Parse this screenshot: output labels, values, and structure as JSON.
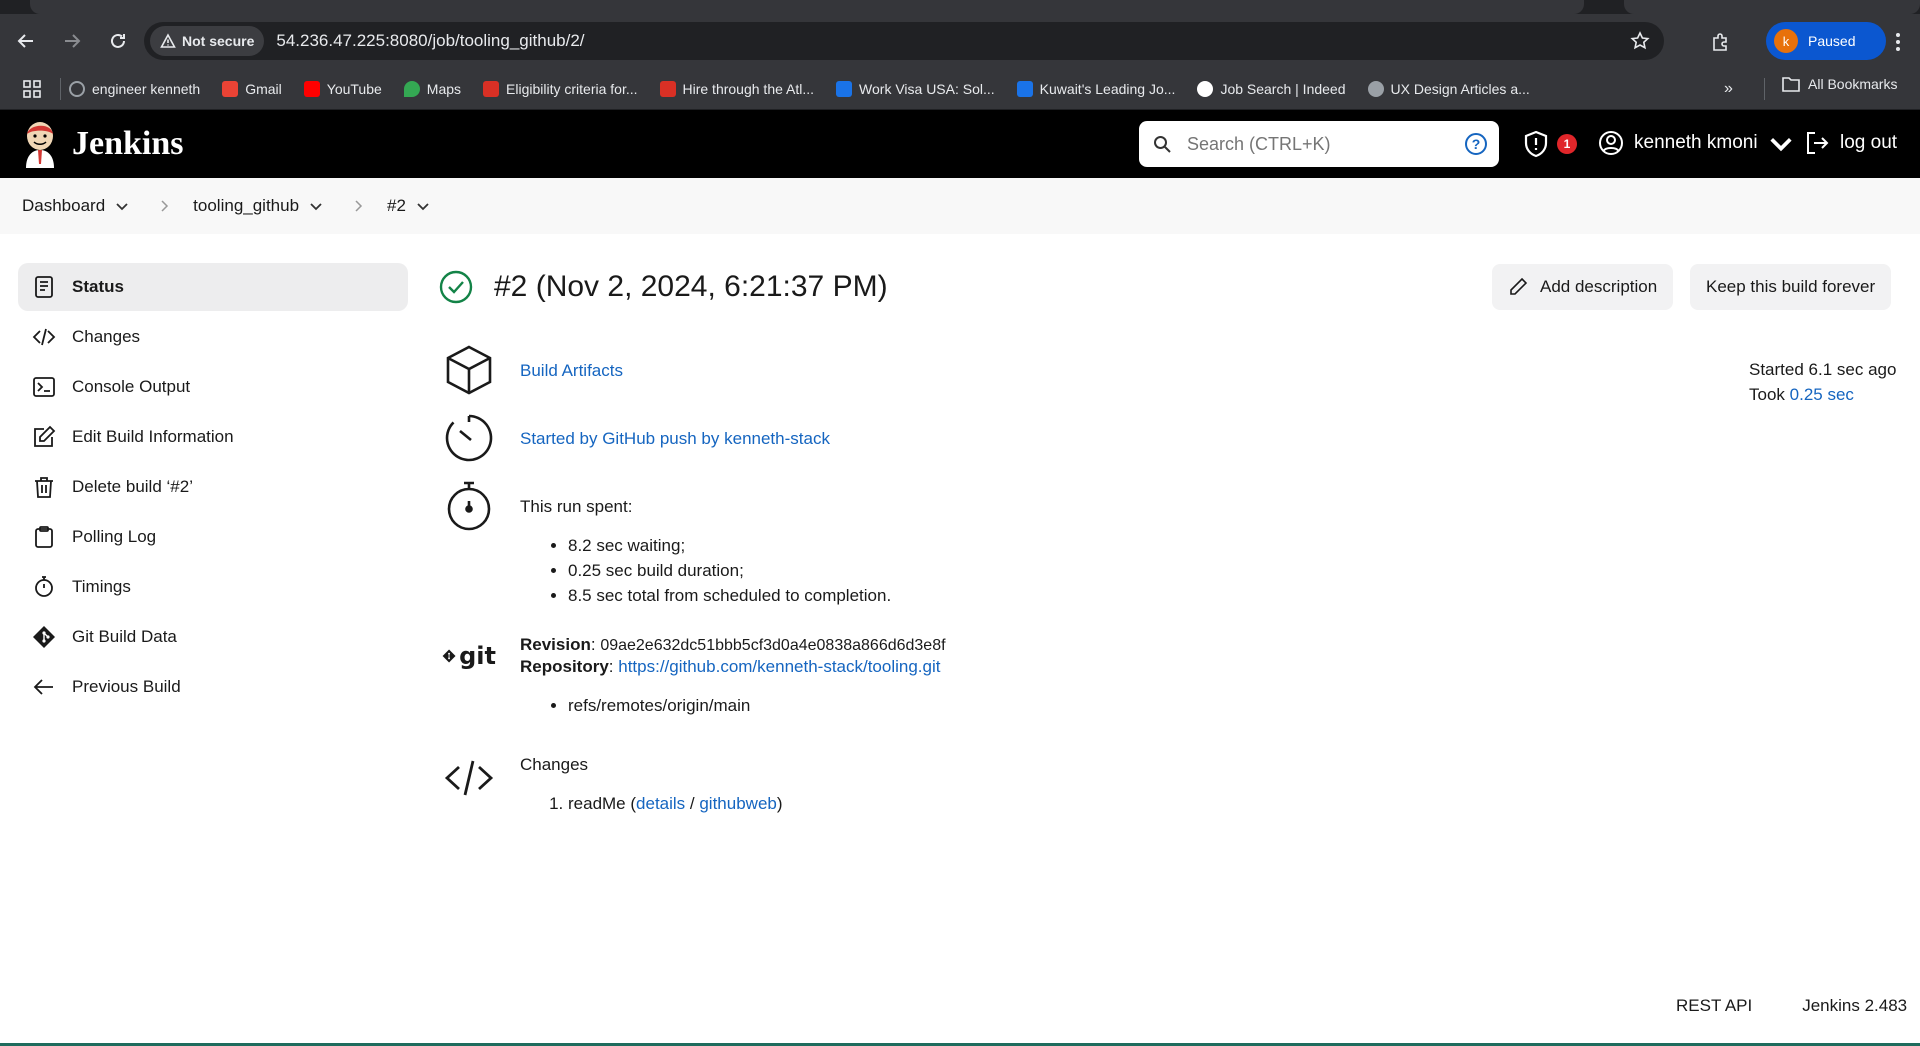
{
  "browser": {
    "security_label": "Not secure",
    "url": "54.236.47.225:8080/job/tooling_github/2/",
    "profile_initial": "k",
    "profile_status": "Paused",
    "bookmarks": [
      {
        "label": "engineer kenneth",
        "color": "#9aa0a6"
      },
      {
        "label": "Gmail",
        "color": "#ea4335"
      },
      {
        "label": "YouTube",
        "color": "#ff0000"
      },
      {
        "label": "Maps",
        "color": "#34a853"
      },
      {
        "label": "Eligibility criteria for...",
        "color": "#d93025"
      },
      {
        "label": "Hire through the Atl...",
        "color": "#d93025"
      },
      {
        "label": "Work Visa USA: Sol...",
        "color": "#1a73e8"
      },
      {
        "label": "Kuwait's Leading Jo...",
        "color": "#1a73e8"
      },
      {
        "label": "Job Search | Indeed",
        "color": "#ffffff"
      },
      {
        "label": "UX Design Articles a...",
        "color": "#9aa0a6"
      }
    ],
    "all_bookmarks": "All Bookmarks"
  },
  "jenkins": {
    "title": "Jenkins",
    "search_placeholder": "Search (CTRL+K)",
    "alert_count": "1",
    "user": "kenneth kmoni",
    "logout": "log out"
  },
  "breadcrumbs": [
    "Dashboard",
    "tooling_github",
    "#2"
  ],
  "sidebar": [
    {
      "label": "Status",
      "icon": "status-icon"
    },
    {
      "label": "Changes",
      "icon": "code-icon"
    },
    {
      "label": "Console Output",
      "icon": "terminal-icon"
    },
    {
      "label": "Edit Build Information",
      "icon": "edit-icon"
    },
    {
      "label": "Delete build ‘#2’",
      "icon": "trash-icon"
    },
    {
      "label": "Polling Log",
      "icon": "clipboard-icon"
    },
    {
      "label": "Timings",
      "icon": "stopwatch-icon"
    },
    {
      "label": "Git Build Data",
      "icon": "git-icon"
    },
    {
      "label": "Previous Build",
      "icon": "arrow-left-icon"
    }
  ],
  "build": {
    "title": "#2 (Nov 2, 2024, 6:21:37 PM)",
    "add_description": "Add description",
    "keep_forever": "Keep this build forever",
    "started_ago": "Started 6.1 sec ago",
    "took_label": "Took",
    "took_value": "0.25 sec",
    "artifacts_link": "Build Artifacts",
    "trigger_link": "Started by GitHub push by kenneth-stack",
    "run_spent_label": "This run spent:",
    "run_spent_items": [
      "8.2 sec waiting;",
      "0.25 sec build duration;",
      "8.5 sec total from scheduled to completion."
    ],
    "git_logo_text": "git",
    "revision_label": "Revision",
    "revision_value": "09ae2e632dc51bbb5cf3d0a4e0838a866d6d3e8f",
    "repository_label": "Repository",
    "repository_url": "https://github.com/kenneth-stack/tooling.git",
    "refs": [
      "refs/remotes/origin/main"
    ],
    "changes_label": "Changes",
    "change_item": "readMe",
    "change_details": "details",
    "change_githubweb": "githubweb"
  },
  "footer": {
    "rest_api": "REST API",
    "version": "Jenkins 2.483"
  },
  "colors": {
    "success": "#138347",
    "link": "#1565c0",
    "alert": "#e0262a",
    "header_bg": "#000000"
  }
}
